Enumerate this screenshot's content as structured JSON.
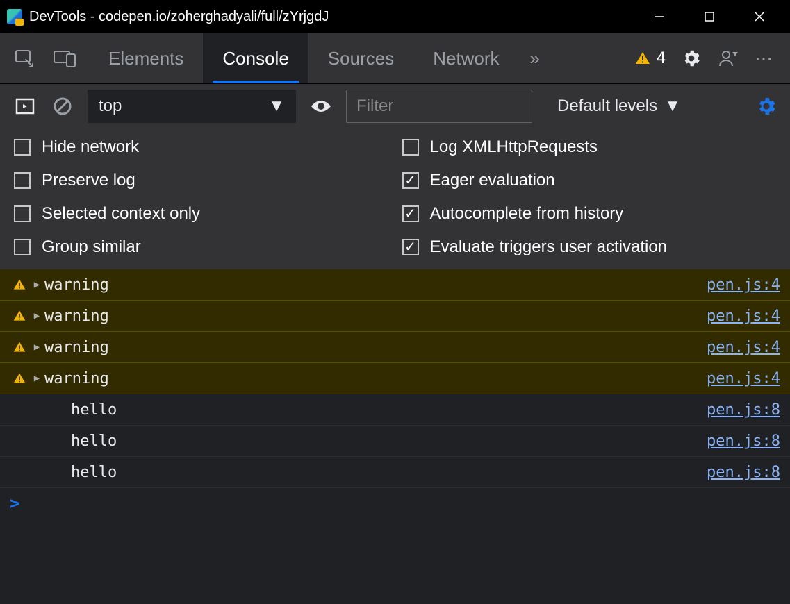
{
  "titlebar": {
    "title": "DevTools - codepen.io/zoherghadyali/full/zYrjgdJ"
  },
  "tabs": {
    "items": [
      "Elements",
      "Console",
      "Sources",
      "Network"
    ],
    "active": "Console",
    "more_glyph": "»"
  },
  "badges": {
    "warning_count": "4"
  },
  "console_toolbar": {
    "context": "top",
    "filter_placeholder": "Filter",
    "levels_label": "Default levels"
  },
  "settings": [
    {
      "label": "Hide network",
      "checked": false
    },
    {
      "label": "Log XMLHttpRequests",
      "checked": false
    },
    {
      "label": "Preserve log",
      "checked": false
    },
    {
      "label": "Eager evaluation",
      "checked": true
    },
    {
      "label": "Selected context only",
      "checked": false
    },
    {
      "label": "Autocomplete from history",
      "checked": true
    },
    {
      "label": "Group similar",
      "checked": false
    },
    {
      "label": "Evaluate triggers user activation",
      "checked": true
    }
  ],
  "logs": [
    {
      "type": "warning",
      "msg": "warning",
      "src": "pen.js:4"
    },
    {
      "type": "warning",
      "msg": "warning",
      "src": "pen.js:4"
    },
    {
      "type": "warning",
      "msg": "warning",
      "src": "pen.js:4"
    },
    {
      "type": "warning",
      "msg": "warning",
      "src": "pen.js:4"
    },
    {
      "type": "info",
      "msg": "hello",
      "src": "pen.js:8"
    },
    {
      "type": "info",
      "msg": "hello",
      "src": "pen.js:8"
    },
    {
      "type": "info",
      "msg": "hello",
      "src": "pen.js:8"
    }
  ],
  "prompt": {
    "caret": ">"
  }
}
